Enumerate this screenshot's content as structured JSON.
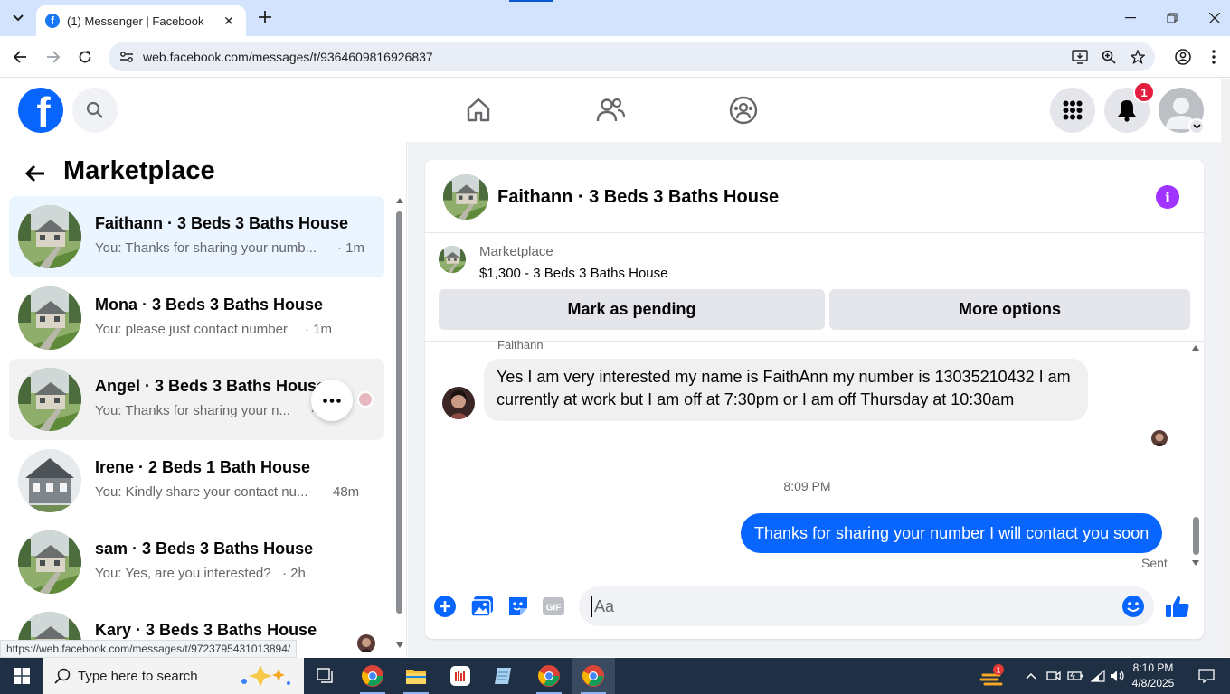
{
  "browser": {
    "tab_title": "(1) Messenger | Facebook",
    "url": "web.facebook.com/messages/t/9364609816926837",
    "status_url": "https://web.facebook.com/messages/t/9723795431013894/"
  },
  "header": {
    "logo_letter": "f",
    "notification_count": "1"
  },
  "left": {
    "title": "Marketplace",
    "conversations": [
      {
        "name": "Faithann · 3 Beds 3 Baths House",
        "preview": "You: Thanks for sharing your numb...",
        "time": "· 1m"
      },
      {
        "name": "Mona · 3 Beds 3 Baths House",
        "preview": "You: please just contact number",
        "time": "· 1m"
      },
      {
        "name": "Angel · 3 Beds 3 Baths House",
        "preview": "You: Thanks for sharing your n...",
        "time": "·"
      },
      {
        "name": "Irene · 2 Beds 1 Bath House",
        "preview": "You: Kindly share your contact nu...",
        "time": "48m"
      },
      {
        "name": "sam · 3 Beds 3 Baths House",
        "preview": "You: Yes, are you interested?",
        "time": "· 2h"
      },
      {
        "name": "Kary · 3 Beds 3 Baths House",
        "preview": "",
        "time": ""
      }
    ]
  },
  "chat": {
    "title": "Faithann · 3 Beds 3 Baths House",
    "marketplace_label": "Marketplace",
    "listing": "$1,300 - 3 Beds 3 Baths House",
    "mark_pending_label": "Mark as pending",
    "more_options_label": "More options",
    "sender_name": "Faithann",
    "incoming_message": "Yes I am very interested my name is FaithAnn my number is 13035210432 I am currently at work but I am off at 7:30pm or I am off Thursday at 10:30am",
    "timestamp": "8:09 PM",
    "outgoing_message": "Thanks for sharing your number I will contact you soon",
    "sent_label": "Sent",
    "composer_placeholder": "Aa",
    "gif_label": "GIF"
  },
  "taskbar": {
    "search_placeholder": "Type here to search",
    "time": "8:10 PM",
    "date": "4/8/2025",
    "weather_badge": "1"
  },
  "colors": {
    "facebook_blue": "#0866ff",
    "notification_red": "#e41e3f",
    "info_purple": "#a033ff"
  }
}
